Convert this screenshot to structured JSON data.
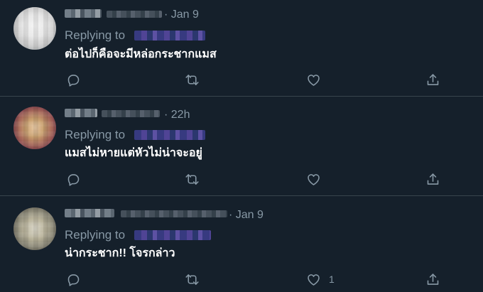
{
  "tweets": [
    {
      "time": "· Jan 9",
      "replying_label": "Replying to",
      "text": "ต่อไปก็คือจะมีหล่อกระชากแมส",
      "like_count": ""
    },
    {
      "time": "· 22h",
      "replying_label": "Replying to",
      "text": "แมสไม่หายแต่หัวไม่น่าจะอยู่",
      "like_count": ""
    },
    {
      "time": "· Jan 9",
      "replying_label": "Replying to",
      "text": "น่ากระชาก!! โจรกล่าว",
      "like_count": "1"
    }
  ],
  "icons": {
    "reply": "reply-icon",
    "retweet": "retweet-icon",
    "like": "heart-icon",
    "share": "share-icon"
  },
  "colors": {
    "background": "#15202b",
    "divider": "#38444d",
    "secondary_text": "#8899a6",
    "primary_text": "#ffffff"
  }
}
